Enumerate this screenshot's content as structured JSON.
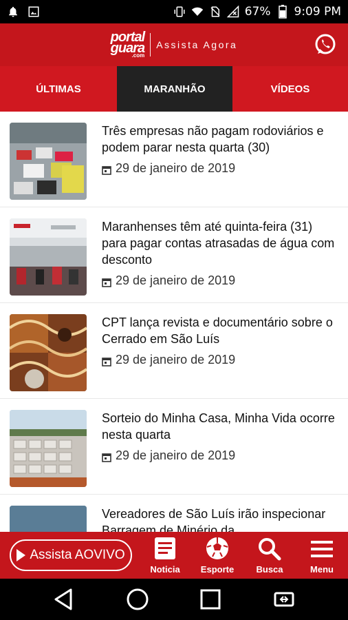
{
  "status_bar": {
    "battery": "67%",
    "time": "9:09 PM"
  },
  "header": {
    "logo_line1": "portal",
    "logo_line2": "guara",
    "logo_suffix": ".com",
    "tagline": "Assista Agora",
    "share_icon": "whatsapp-icon"
  },
  "tabs": [
    {
      "label": "ÚLTIMAS",
      "active": false
    },
    {
      "label": "MARANHÃO",
      "active": true
    },
    {
      "label": "VÍDEOS",
      "active": false
    }
  ],
  "articles": [
    {
      "title": "Três empresas não pagam rodoviários e podem parar nesta quarta (30)",
      "date": "29 de janeiro de 2019"
    },
    {
      "title": "Maranhenses têm até quinta-feira (31) para pagar contas atrasadas de água com desconto",
      "date": "29 de janeiro de 2019"
    },
    {
      "title": "CPT lança revista e documentário sobre o Cerrado em São Luís",
      "date": "29 de janeiro de 2019"
    },
    {
      "title": "Sorteio do Minha Casa, Minha Vida ocorre nesta quarta",
      "date": "29 de janeiro de 2019"
    },
    {
      "title": "Vereadores de São Luís irão inspecionar Barragem de Minério da",
      "date": ""
    }
  ],
  "bottom_bar": {
    "live_button": "Assista AOVIVO",
    "items": [
      {
        "label": "Noticia",
        "icon": "news-icon"
      },
      {
        "label": "Esporte",
        "icon": "soccer-ball-icon"
      },
      {
        "label": "Busca",
        "icon": "search-icon"
      },
      {
        "label": "Menu",
        "icon": "hamburger-menu-icon"
      }
    ]
  },
  "colors": {
    "brand_red": "#c4161c",
    "active_tab": "#222222"
  }
}
